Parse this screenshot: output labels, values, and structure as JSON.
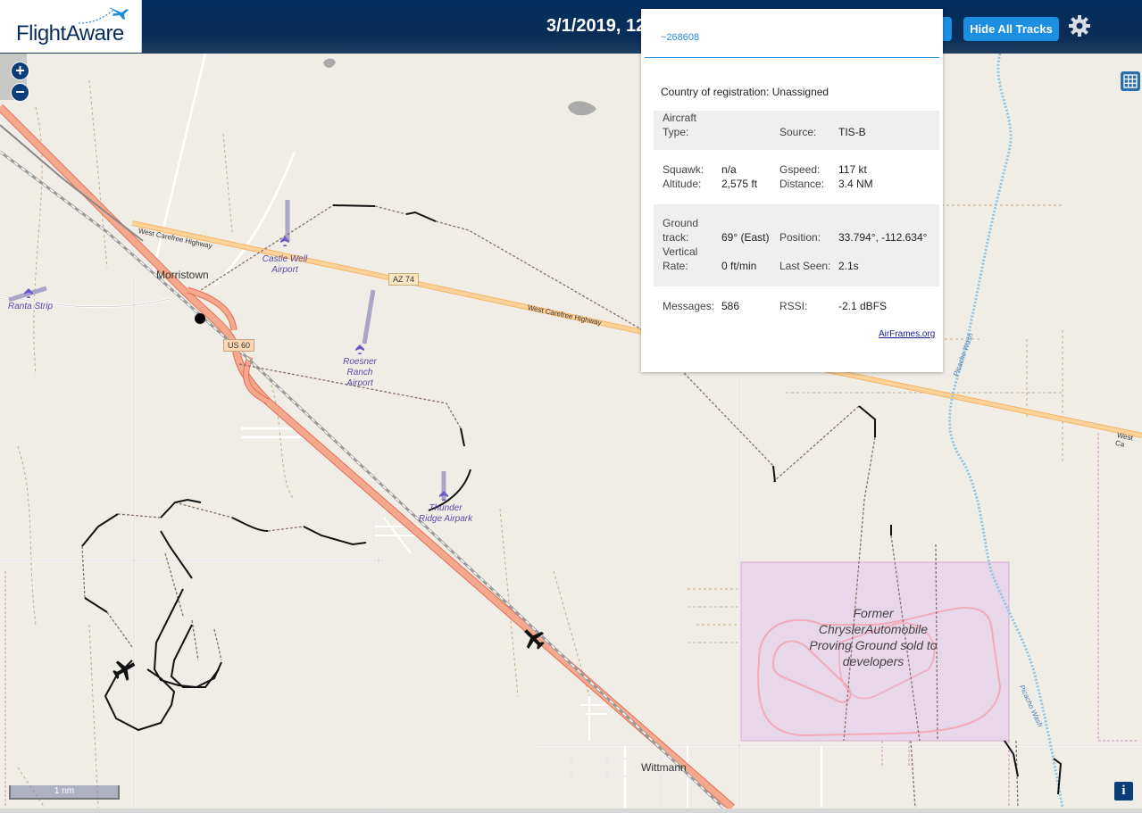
{
  "header": {
    "brand": "FlightAware",
    "datetime": "3/1/2019, 12",
    "hide_tracks_label": "Hide All Tracks",
    "settings_icon": "gear-icon"
  },
  "popup": {
    "ident": "~268608",
    "country_label": "Country of registration:",
    "country_value": "Unassigned",
    "aircraft_type_label": "Aircraft Type:",
    "aircraft_type_value": "",
    "source_label": "Source:",
    "source_value": "TIS-B",
    "squawk_label": "Squawk:",
    "squawk_value": "n/a",
    "altitude_label": "Altitude:",
    "altitude_value": "2,575 ft",
    "gspeed_label": "Gspeed:",
    "gspeed_value": "117 kt",
    "distance_label": "Distance:",
    "distance_value": "3.4 NM",
    "ground_track_label": "Ground track:",
    "ground_track_value": "69° (East)",
    "position_label": "Position:",
    "position_value": "33.794°, -112.634°",
    "vertical_rate_label": "Vertical Rate:",
    "vertical_rate_value": "0 ft/min",
    "last_seen_label": "Last Seen:",
    "last_seen_value": "2.1s",
    "messages_label": "Messages:",
    "messages_value": "586",
    "rssi_label": "RSSI:",
    "rssi_value": "-2.1 dBFS",
    "airframes_link": "AirFrames.org"
  },
  "map": {
    "zoom_in": "+",
    "zoom_out": "−",
    "scale_label": "1 nm",
    "info_label": "i",
    "places": {
      "morristown": "Morristown",
      "wittmann": "Wittmann",
      "castle_well": "Castle Well\nAirport",
      "ranta": "Ranta Strip",
      "roesner": "Roesner\nRanch\nAirport",
      "thunder": "Thunder\nRidge Airpark",
      "chrysler": "Former ChryslerAutomobile Proving Ground sold to developers"
    },
    "roads": {
      "west_carefree_1": "West Carefree Highway",
      "west_carefree_2": "West Carefree Highway",
      "west_carefree_3": "West Ca",
      "az74": "AZ 74",
      "us60": "US 60",
      "picacho_1": "Picacho Wash",
      "picacho_2": "Picacho Wash"
    }
  }
}
